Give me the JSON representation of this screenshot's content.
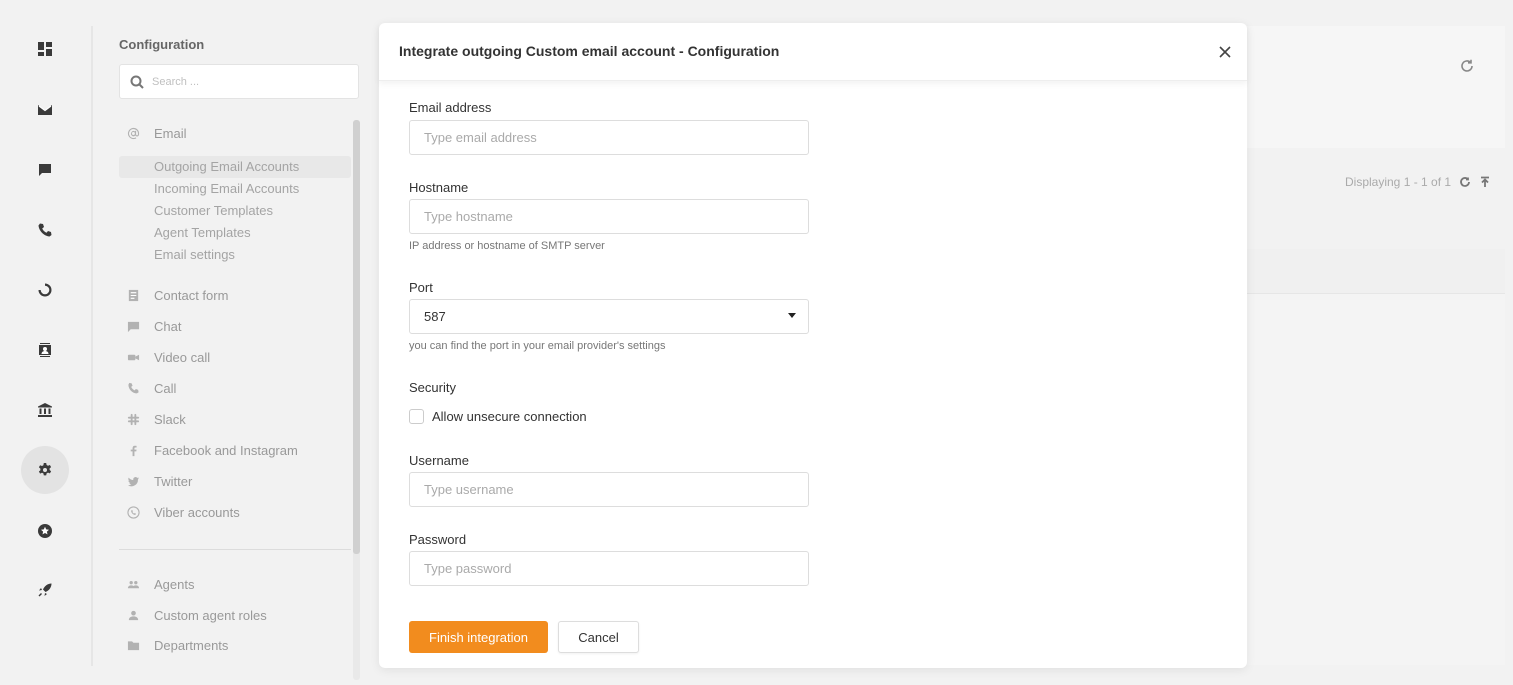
{
  "rail": {
    "items": [
      {
        "icon": "dashboard-icon"
      },
      {
        "icon": "envelope-icon"
      },
      {
        "icon": "chat-bubble-icon"
      },
      {
        "icon": "phone-icon"
      },
      {
        "icon": "reports-circle-icon"
      },
      {
        "icon": "contacts-icon"
      },
      {
        "icon": "bank-icon"
      },
      {
        "icon": "gear-icon",
        "active": true
      },
      {
        "icon": "star-icon"
      },
      {
        "icon": "rocket-icon"
      }
    ]
  },
  "config": {
    "title": "Configuration",
    "search_placeholder": "Search ...",
    "email_section": "Email",
    "email_items": [
      "Outgoing Email Accounts",
      "Incoming Email Accounts",
      "Customer Templates",
      "Agent Templates",
      "Email settings"
    ],
    "sections": [
      "Contact form",
      "Chat",
      "Video call",
      "Call",
      "Slack",
      "Facebook and Instagram",
      "Twitter",
      "Viber accounts"
    ],
    "lower_sections": [
      "Agents",
      "Custom agent roles",
      "Departments"
    ]
  },
  "background": {
    "displaying": "Displaying 1 - 1 of 1"
  },
  "modal": {
    "title": "Integrate outgoing Custom email account - Configuration",
    "email_label": "Email address",
    "email_placeholder": "Type email address",
    "hostname_label": "Hostname",
    "hostname_placeholder": "Type hostname",
    "hostname_hint": "IP address or hostname of SMTP server",
    "port_label": "Port",
    "port_value": "587",
    "port_hint": "you can find the port in your email provider's settings",
    "security_label": "Security",
    "unsecure_label": "Allow unsecure connection",
    "username_label": "Username",
    "username_placeholder": "Type username",
    "password_label": "Password",
    "password_placeholder": "Type password",
    "finish_label": "Finish integration",
    "cancel_label": "Cancel"
  },
  "colors": {
    "accent": "#f28c1e",
    "rail_active": "#e3e3e3"
  }
}
